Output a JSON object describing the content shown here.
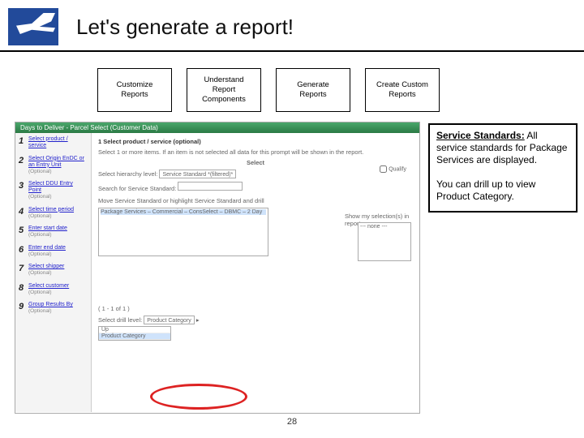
{
  "header": {
    "title": "Let's generate a report!"
  },
  "nav": {
    "items": [
      {
        "label": "Customize Reports"
      },
      {
        "label": "Understand Report Components"
      },
      {
        "label": "Generate Reports"
      },
      {
        "label": "Create Custom Reports"
      }
    ]
  },
  "screenshot": {
    "window_title": "Days to Deliver - Parcel Select (Customer Data)",
    "steps": [
      {
        "n": "1",
        "label": "Select product / service",
        "optional": ""
      },
      {
        "n": "2",
        "label": "Select Origin EnDC or an Entry Unit",
        "optional": "(Optional)"
      },
      {
        "n": "3",
        "label": "Select DDU Entry Point",
        "optional": "(Optional)"
      },
      {
        "n": "4",
        "label": "Select time period",
        "optional": "(Optional)"
      },
      {
        "n": "5",
        "label": "Enter start date",
        "optional": "(Optional)"
      },
      {
        "n": "6",
        "label": "Enter end date",
        "optional": "(Optional)"
      },
      {
        "n": "7",
        "label": "Select shipper",
        "optional": "(Optional)"
      },
      {
        "n": "8",
        "label": "Select customer",
        "optional": "(Optional)"
      },
      {
        "n": "9",
        "label": "Group Results By",
        "optional": "(Optional)"
      }
    ],
    "panel": {
      "heading": "1 Select product / service (optional)",
      "instruction": "Select 1 or more items. If an item is not selected all data for this prompt will be shown in the report.",
      "select_label": "Select",
      "qualify_label": "Qualify",
      "hierarchy_label": "Select hierarchy level:",
      "hierarchy_value": "Service Standard *(filtered)*",
      "search_label": "Search for Service Standard:",
      "move_hint": "Move Service Standard or highlight Service Standard and drill",
      "selected_item": "Package Services – Commercial – ConsSelect – DBMC – 2 Day",
      "show_label": "Show my selection(s) in report",
      "show_none": "--- none ---",
      "count": "( 1 - 1 of 1 )",
      "drill_label": "Select drill level:",
      "drill_value": "Product Category",
      "drill_up": "Up",
      "drill_opt": "Product Category"
    }
  },
  "callout": {
    "heading": "Service Standards:",
    "body1": "All service standards for Package Services are displayed.",
    "body2": "You can drill up to view Product Category."
  },
  "page_number": "28"
}
